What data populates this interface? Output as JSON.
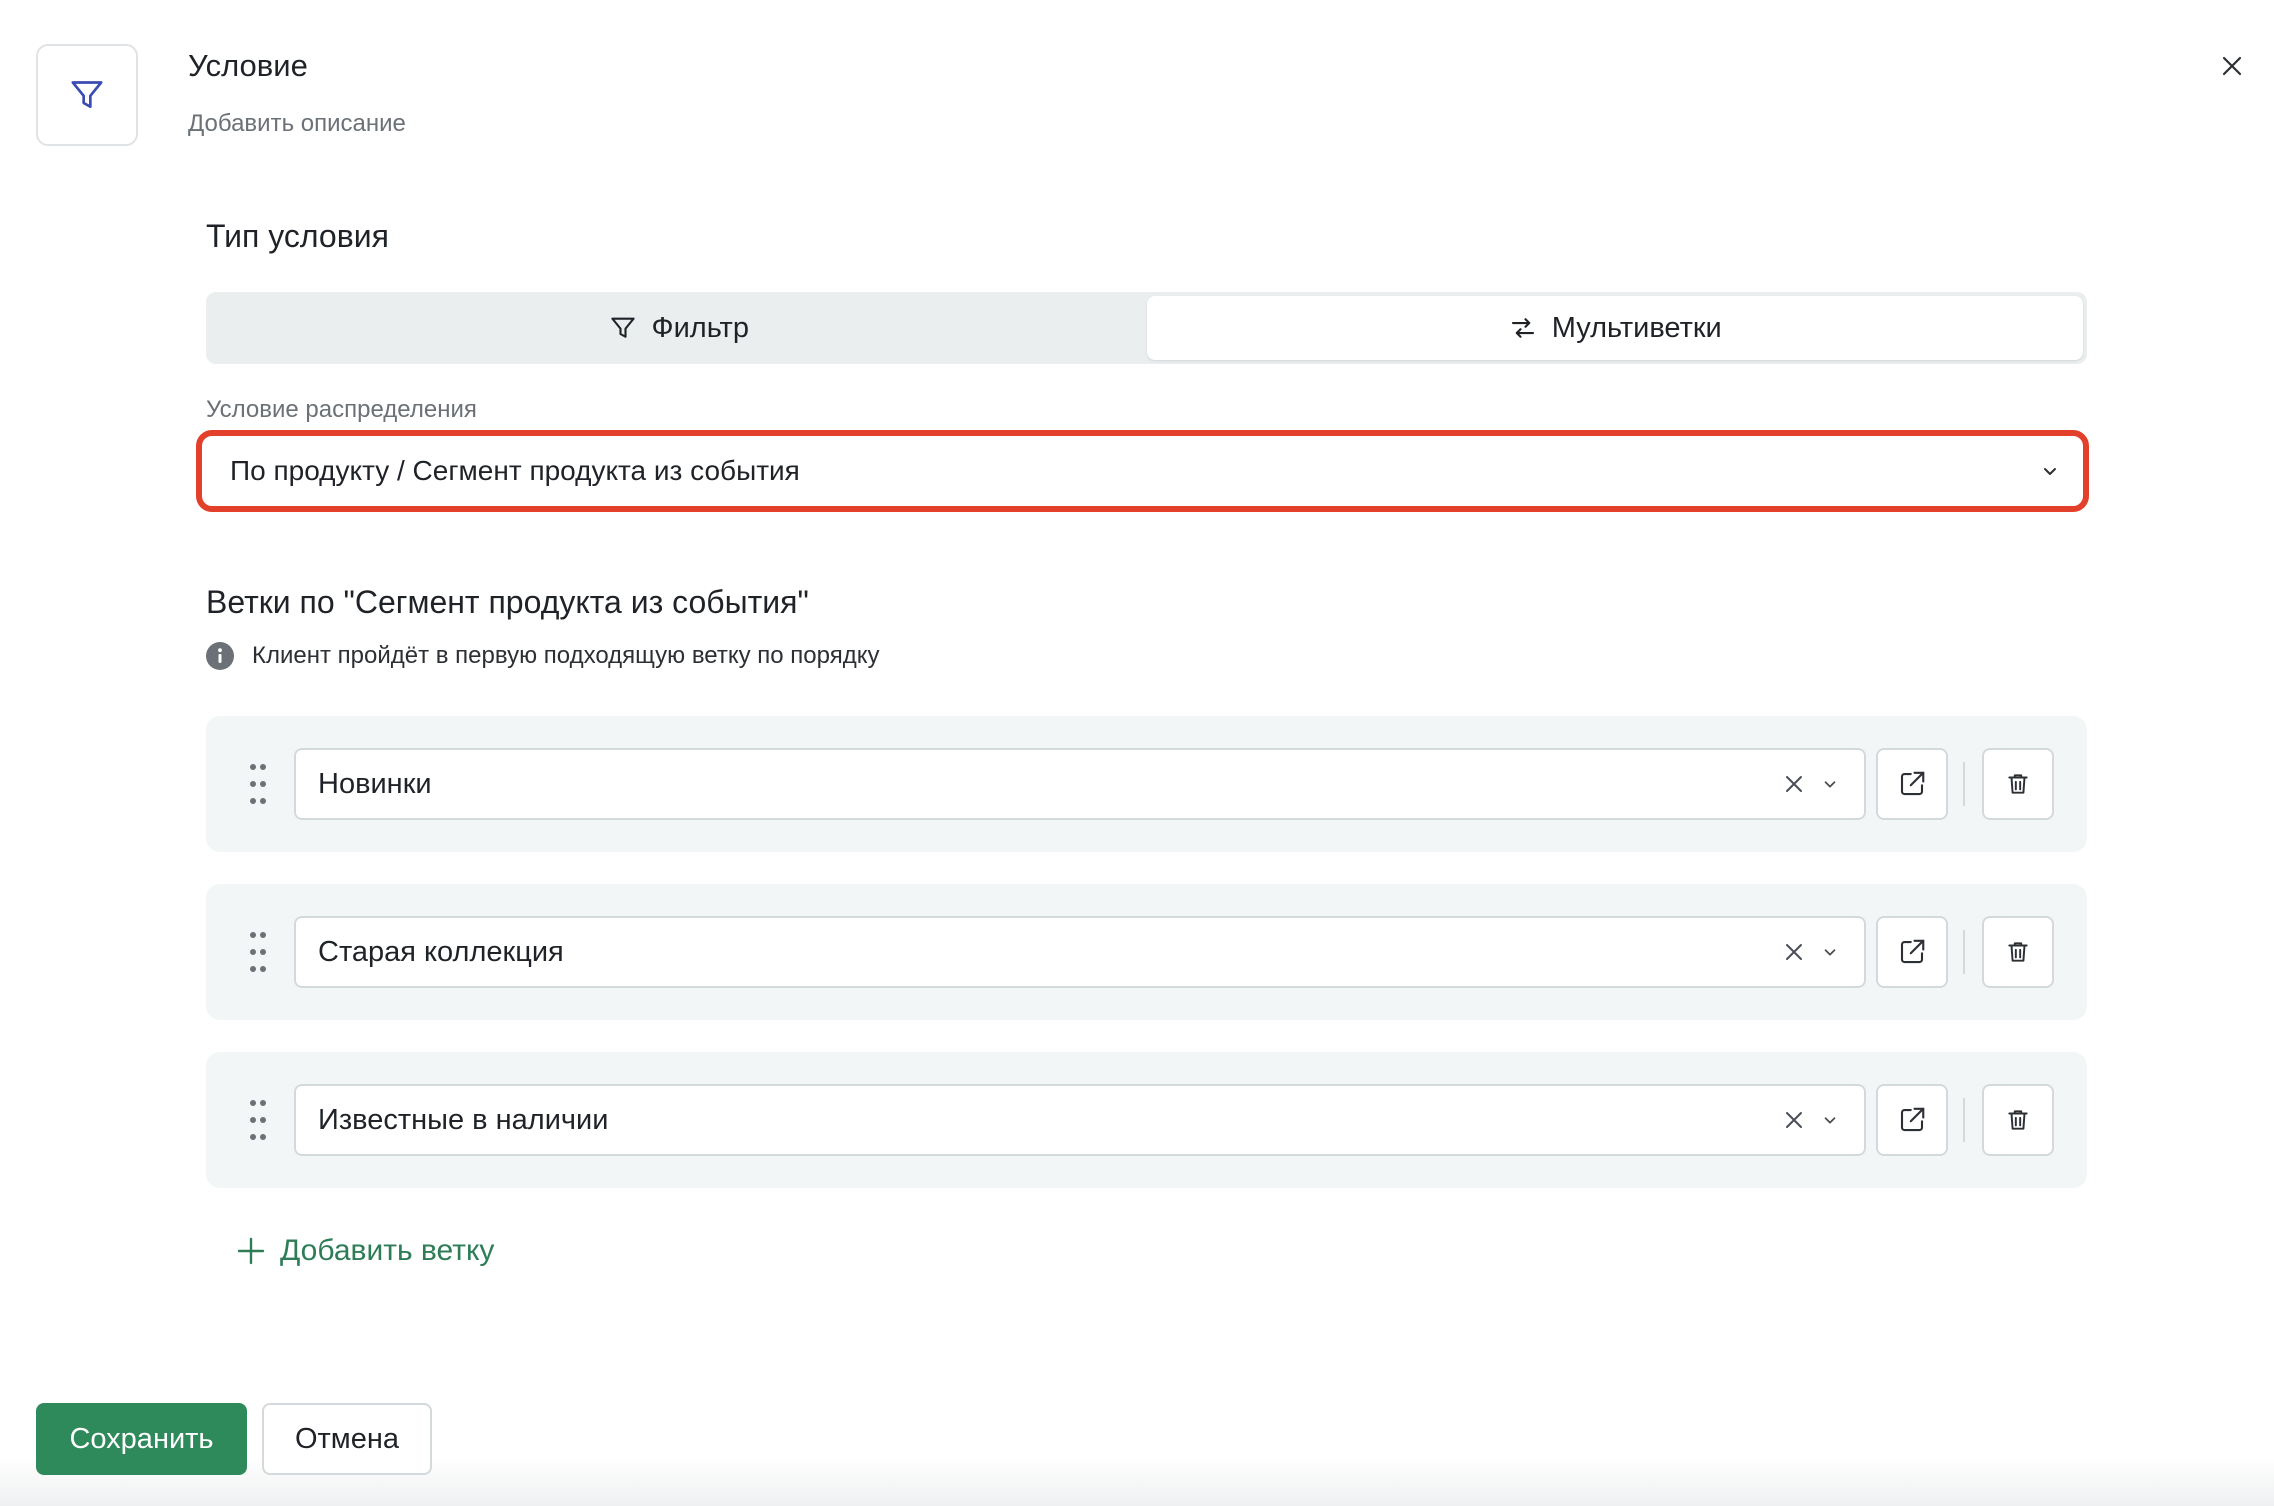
{
  "header": {
    "icon": "filter-icon",
    "title": "Условие",
    "description_placeholder": "Добавить описание",
    "close_icon": "close-icon"
  },
  "condition_type": {
    "title": "Тип условия",
    "options": [
      {
        "label": "Фильтр",
        "icon": "filter-icon",
        "selected": false
      },
      {
        "label": "Мультиветки",
        "icon": "multibranch-icon",
        "selected": true
      }
    ]
  },
  "distribution": {
    "label": "Условие распределения",
    "value": "По продукту / Сегмент продукта из события",
    "highlight_color": "#e2402a"
  },
  "branches": {
    "title": "Ветки по \"Сегмент продукта из события\"",
    "info": "Клиент пройдёт в первую подходящую ветку по порядку",
    "items": [
      {
        "value": "Новинки"
      },
      {
        "value": "Старая коллекция"
      },
      {
        "value": "Известные в наличии"
      }
    ],
    "add_label": "Добавить ветку"
  },
  "footer": {
    "save_label": "Сохранить",
    "cancel_label": "Отмена"
  },
  "colors": {
    "accent": "#2f8a5b",
    "link": "#2e7d57",
    "icon_blue": "#3b4bb3"
  }
}
